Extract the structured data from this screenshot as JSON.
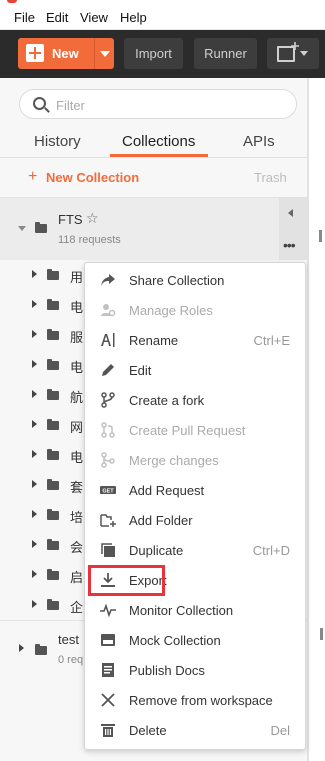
{
  "menubar": {
    "items": [
      "File",
      "Edit",
      "View",
      "Help"
    ]
  },
  "toolbar": {
    "new_label": "New",
    "import_label": "Import",
    "runner_label": "Runner",
    "accent": "#f26b3a"
  },
  "search": {
    "placeholder": "Filter"
  },
  "tabs": [
    {
      "label": "History",
      "active": false
    },
    {
      "label": "Collections",
      "active": true
    },
    {
      "label": "APIs",
      "active": false
    }
  ],
  "collections_header": {
    "new_label": "New Collection",
    "trash_label": "Trash"
  },
  "collections": [
    {
      "name": "FTS",
      "subtitle": "118 requests"
    },
    {
      "name": "test",
      "subtitle": "0 req"
    }
  ],
  "subfolders": [
    "用",
    "电",
    "服",
    "电",
    "航",
    "网",
    "电",
    "套",
    "培",
    "会",
    "启",
    "企"
  ],
  "context_menu": {
    "items": [
      {
        "label": "Share Collection",
        "shortcut": "",
        "disabled": false,
        "icon": "share-icon"
      },
      {
        "label": "Manage Roles",
        "shortcut": "",
        "disabled": true,
        "icon": "manage-roles-icon"
      },
      {
        "label": "Rename",
        "shortcut": "Ctrl+E",
        "disabled": false,
        "icon": "rename-icon"
      },
      {
        "label": "Edit",
        "shortcut": "",
        "disabled": false,
        "icon": "pencil-icon"
      },
      {
        "label": "Create a fork",
        "shortcut": "",
        "disabled": false,
        "icon": "fork-icon"
      },
      {
        "label": "Create Pull Request",
        "shortcut": "",
        "disabled": true,
        "icon": "pull-request-icon"
      },
      {
        "label": "Merge changes",
        "shortcut": "",
        "disabled": true,
        "icon": "merge-icon"
      },
      {
        "label": "Add Request",
        "shortcut": "",
        "disabled": false,
        "icon": "get-request-icon"
      },
      {
        "label": "Add Folder",
        "shortcut": "",
        "disabled": false,
        "icon": "add-folder-icon"
      },
      {
        "label": "Duplicate",
        "shortcut": "Ctrl+D",
        "disabled": false,
        "icon": "duplicate-icon"
      },
      {
        "label": "Export",
        "shortcut": "",
        "disabled": false,
        "icon": "export-icon"
      },
      {
        "label": "Monitor Collection",
        "shortcut": "",
        "disabled": false,
        "icon": "monitor-icon"
      },
      {
        "label": "Mock Collection",
        "shortcut": "",
        "disabled": false,
        "icon": "mock-server-icon"
      },
      {
        "label": "Publish Docs",
        "shortcut": "",
        "disabled": false,
        "icon": "docs-icon"
      },
      {
        "label": "Remove from workspace",
        "shortcut": "",
        "disabled": false,
        "icon": "close-icon"
      },
      {
        "label": "Delete",
        "shortcut": "Del",
        "disabled": false,
        "icon": "trash-icon"
      }
    ],
    "highlight_color": "#e8323c"
  }
}
